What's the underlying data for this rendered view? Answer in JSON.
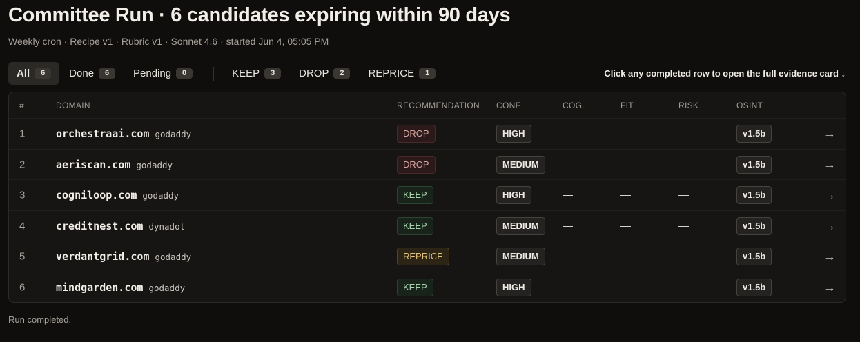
{
  "header": {
    "title": "Committee Run · 6 candidates expiring within 90 days",
    "subtitle": "Weekly cron · Recipe v1 · Rubric v1 · Sonnet 4.6 · started Jun 4, 05:05 PM"
  },
  "filters": [
    {
      "label": "All",
      "count": "6"
    },
    {
      "label": "Done",
      "count": "6"
    },
    {
      "label": "Pending",
      "count": "0"
    },
    {
      "label": "KEEP",
      "count": "3"
    },
    {
      "label": "DROP",
      "count": "2"
    },
    {
      "label": "REPRICE",
      "count": "1"
    }
  ],
  "hint": "Click any completed row to open the full evidence card ↓",
  "table": {
    "columns": [
      "#",
      "DOMAIN",
      "RECOMMENDATION",
      "CONF",
      "COG.",
      "FIT",
      "RISK",
      "OSINT"
    ],
    "rows": [
      {
        "num": "1",
        "domain": "orchestraai.com",
        "registrar": "godaddy",
        "rec": "DROP",
        "conf": "HIGH",
        "cog": "—",
        "fit": "—",
        "risk": "—",
        "osint": "v1.5b"
      },
      {
        "num": "2",
        "domain": "aeriscan.com",
        "registrar": "godaddy",
        "rec": "DROP",
        "conf": "MEDIUM",
        "cog": "—",
        "fit": "—",
        "risk": "—",
        "osint": "v1.5b"
      },
      {
        "num": "3",
        "domain": "cogniloop.com",
        "registrar": "godaddy",
        "rec": "KEEP",
        "conf": "HIGH",
        "cog": "—",
        "fit": "—",
        "risk": "—",
        "osint": "v1.5b"
      },
      {
        "num": "4",
        "domain": "creditnest.com",
        "registrar": "dynadot",
        "rec": "KEEP",
        "conf": "MEDIUM",
        "cog": "—",
        "fit": "—",
        "risk": "—",
        "osint": "v1.5b"
      },
      {
        "num": "5",
        "domain": "verdantgrid.com",
        "registrar": "godaddy",
        "rec": "REPRICE",
        "conf": "MEDIUM",
        "cog": "—",
        "fit": "—",
        "risk": "—",
        "osint": "v1.5b"
      },
      {
        "num": "6",
        "domain": "mindgarden.com",
        "registrar": "godaddy",
        "rec": "KEEP",
        "conf": "HIGH",
        "cog": "—",
        "fit": "—",
        "risk": "—",
        "osint": "v1.5b"
      }
    ],
    "row_arrow_icon": "→"
  },
  "footer": "Run completed."
}
